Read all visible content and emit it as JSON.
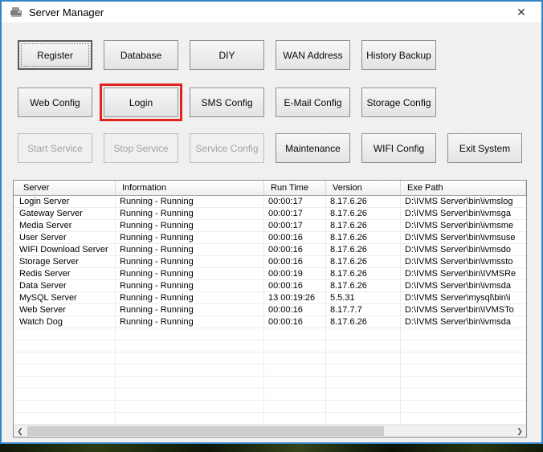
{
  "window": {
    "title": "Server Manager",
    "close_glyph": "✕"
  },
  "toolbar": {
    "row1": [
      "Register",
      "Database",
      "DIY",
      "WAN Address",
      "History Backup"
    ],
    "row2": [
      "Web Config",
      "Login",
      "SMS Config",
      "E-Mail Config",
      "Storage Config"
    ],
    "row3": [
      "Start Service",
      "Stop Service",
      "Service Config",
      "Maintenance",
      "WIFI Config",
      "Exit System"
    ]
  },
  "annotation": {
    "highlight_color": "#e3241c"
  },
  "table": {
    "columns": [
      "Server",
      "Information",
      "Run Time",
      "Version",
      "Exe Path"
    ],
    "rows": [
      {
        "server": "Login Server",
        "information": "Running - Running",
        "run_time": "00:00:17",
        "version": "8.17.6.26",
        "exe_path": "D:\\IVMS Server\\bin\\ivmslog"
      },
      {
        "server": "Gateway Server",
        "information": "Running - Running",
        "run_time": "00:00:17",
        "version": "8.17.6.26",
        "exe_path": "D:\\IVMS Server\\bin\\ivmsga"
      },
      {
        "server": "Media Server",
        "information": "Running - Running",
        "run_time": "00:00:17",
        "version": "8.17.6.26",
        "exe_path": "D:\\IVMS Server\\bin\\ivmsme"
      },
      {
        "server": "User Server",
        "information": "Running - Running",
        "run_time": "00:00:16",
        "version": "8.17.6.26",
        "exe_path": "D:\\IVMS Server\\bin\\ivmsuse"
      },
      {
        "server": "WIFI Download Server",
        "information": "Running - Running",
        "run_time": "00:00:16",
        "version": "8.17.6.26",
        "exe_path": "D:\\IVMS Server\\bin\\ivmsdo"
      },
      {
        "server": "Storage Server",
        "information": "Running - Running",
        "run_time": "00:00:16",
        "version": "8.17.6.26",
        "exe_path": "D:\\IVMS Server\\bin\\ivmssto"
      },
      {
        "server": "Redis Server",
        "information": "Running - Running",
        "run_time": "00:00:19",
        "version": "8.17.6.26",
        "exe_path": "D:\\IVMS Server\\bin\\IVMSRe"
      },
      {
        "server": "Data Server",
        "information": "Running - Running",
        "run_time": "00:00:16",
        "version": "8.17.6.26",
        "exe_path": "D:\\IVMS Server\\bin\\ivmsda"
      },
      {
        "server": "MySQL Server",
        "information": "Running - Running",
        "run_time": "13 00:19:26",
        "version": "5.5.31",
        "exe_path": "D:\\IVMS Server\\mysql\\bin\\i"
      },
      {
        "server": "Web Server",
        "information": "Running - Running",
        "run_time": "00:00:16",
        "version": "8.17.7.7",
        "exe_path": "D:\\IVMS Server\\bin\\IVMSTo"
      },
      {
        "server": "Watch Dog",
        "information": "Running - Running",
        "run_time": "00:00:16",
        "version": "8.17.6.26",
        "exe_path": "D:\\IVMS Server\\bin\\ivmsda"
      }
    ]
  },
  "scrollbar": {
    "left_arrow": "❮",
    "right_arrow": "❯"
  }
}
